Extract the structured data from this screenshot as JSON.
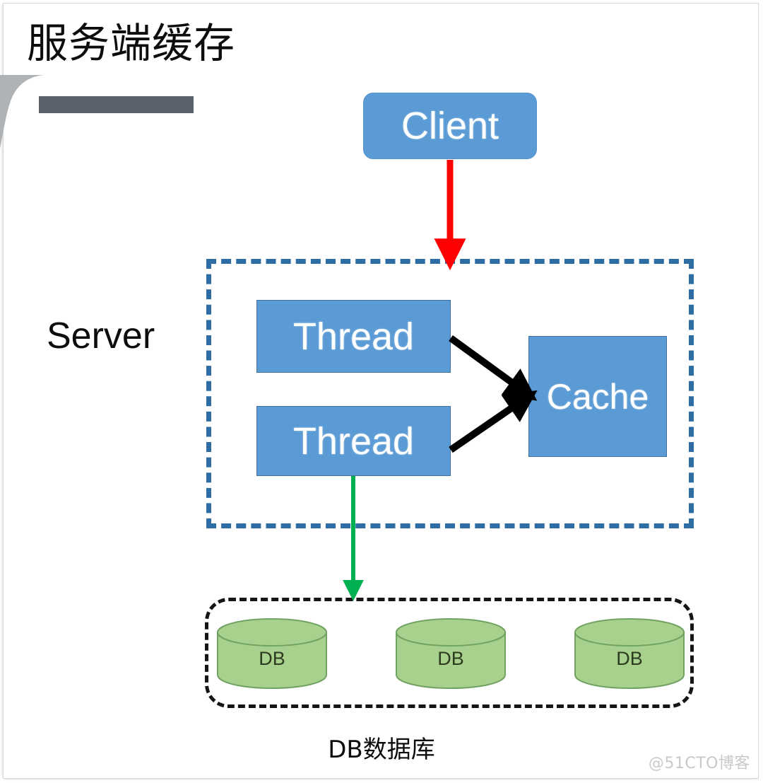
{
  "slide": {
    "title": "服务端缓存",
    "caption": "DB数据库",
    "watermark": "@51CTO博客"
  },
  "nodes": {
    "client": {
      "label": "Client"
    },
    "server": {
      "label": "Server"
    },
    "threads": [
      {
        "label": "Thread"
      },
      {
        "label": "Thread"
      }
    ],
    "cache": {
      "label": "Cache"
    },
    "databases": [
      {
        "label": "DB"
      },
      {
        "label": "DB"
      },
      {
        "label": "DB"
      }
    ]
  },
  "colors": {
    "node_blue": "#5b9bd5",
    "node_blue_border": "#41719c",
    "server_dash": "#2e6da4",
    "db_dash": "#151515",
    "db_green": "#a9d18e",
    "db_green_border": "#70a262",
    "arrow_client": "#ff0000",
    "arrow_cache": "#000000",
    "arrow_db": "#00b050",
    "title_rule": "#59626b",
    "watermark": "#c9c9c9"
  },
  "icons": {
    "decoration": "banner-swoosh-icon",
    "database": "database-cylinder-icon",
    "arrow_client_to_server": "down-arrow-icon",
    "arrow_thread_to_cache": "diagonal-arrow-icon",
    "arrow_thread_to_db": "down-arrow-icon"
  }
}
